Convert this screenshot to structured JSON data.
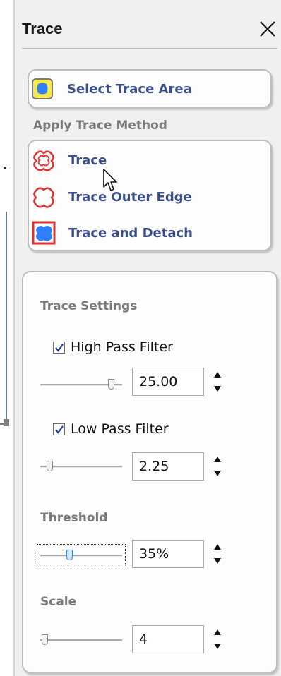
{
  "panel": {
    "title": "Trace"
  },
  "select_area": {
    "label": "Select Trace Area"
  },
  "apply_method": {
    "heading": "Apply Trace Method",
    "items": [
      {
        "label": "Trace",
        "icon": "trace-icon"
      },
      {
        "label": "Trace Outer Edge",
        "icon": "trace-outer-edge-icon"
      },
      {
        "label": "Trace and Detach",
        "icon": "trace-detach-icon"
      }
    ]
  },
  "settings": {
    "heading": "Trace Settings",
    "high_pass": {
      "label": "High Pass Filter",
      "checked": true,
      "value": "25.00",
      "slider_fraction": 0.9
    },
    "low_pass": {
      "label": "Low Pass Filter",
      "checked": true,
      "value": "2.25",
      "slider_fraction": 0.08
    },
    "threshold": {
      "label": "Threshold",
      "value": "35%",
      "slider_fraction": 0.35
    },
    "scale": {
      "label": "Scale",
      "value": "4",
      "slider_fraction": 0.02
    }
  },
  "colors": {
    "accent_text": "#3a4f8a",
    "trace_red": "#e03030",
    "trace_blue": "#2f7fff",
    "select_yellow": "#f5e84a"
  }
}
